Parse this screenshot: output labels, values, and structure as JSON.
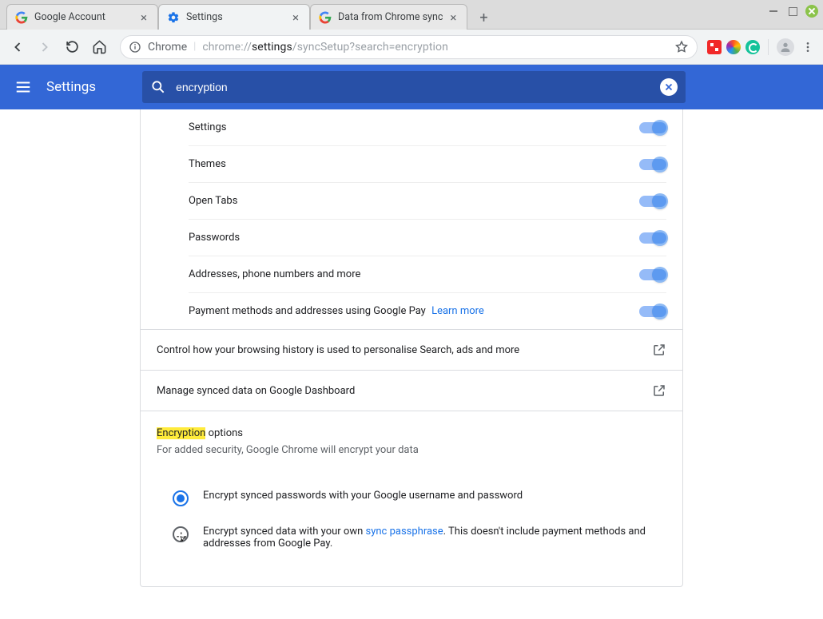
{
  "window": {
    "tabs": [
      {
        "title": "Google Account",
        "favicon": "google-g"
      },
      {
        "title": "Settings",
        "favicon": "gear",
        "active": true
      },
      {
        "title": "Data from Chrome sync",
        "favicon": "google-g"
      }
    ]
  },
  "toolbar": {
    "scheme_label": "Chrome",
    "url_prefix": "chrome://",
    "url_bold": "settings",
    "url_rest": "/syncSetup?search=encryption"
  },
  "header": {
    "title": "Settings",
    "search_value": "encryption"
  },
  "sync_items": [
    {
      "label": "Settings",
      "on": true
    },
    {
      "label": "Themes",
      "on": true
    },
    {
      "label": "Open Tabs",
      "on": true
    },
    {
      "label": "Passwords",
      "on": true
    },
    {
      "label": "Addresses, phone numbers and more",
      "on": true
    },
    {
      "label": "Payment methods and addresses using Google Pay",
      "on": true,
      "learn_more": "Learn more"
    }
  ],
  "link_rows": [
    {
      "label": "Control how your browsing history is used to personalise Search, ads and more"
    },
    {
      "label": "Manage synced data on Google Dashboard"
    }
  ],
  "encryption_section": {
    "heading_hl": "Encryption",
    "heading_rest": " options",
    "sub": "For added security, Google Chrome will encrypt your data",
    "options": [
      {
        "label": "Encrypt synced passwords with your Google username and password",
        "checked": true
      },
      {
        "label_pre": "Encrypt synced data with your own ",
        "link": "sync passphrase",
        "label_post": ". This doesn't include payment methods and addresses from Google Pay.",
        "checked": false
      }
    ]
  }
}
